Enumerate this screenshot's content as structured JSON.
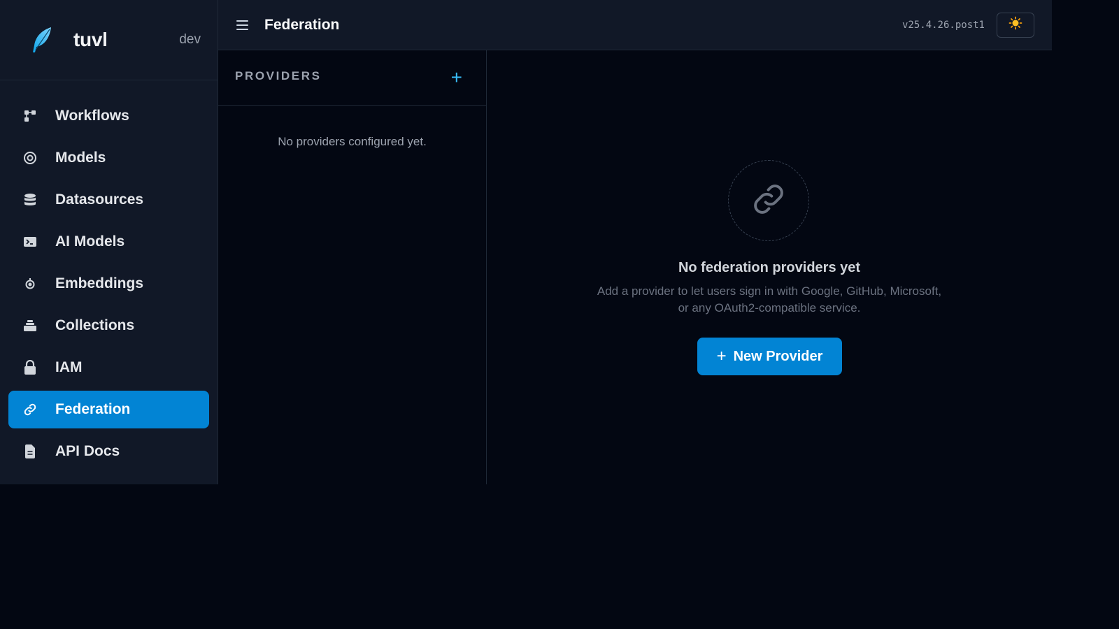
{
  "brand": {
    "name": "tuvl",
    "env": "dev",
    "logo_icon": "feather-logo-icon",
    "accent": "#0284d4"
  },
  "sidebar": {
    "items": [
      {
        "label": "Workflows",
        "icon": "workflow-icon",
        "active": false
      },
      {
        "label": "Models",
        "icon": "target-icon",
        "active": false
      },
      {
        "label": "Datasources",
        "icon": "database-icon",
        "active": false
      },
      {
        "label": "AI Models",
        "icon": "terminal-icon",
        "active": false
      },
      {
        "label": "Embeddings",
        "icon": "embedding-icon",
        "active": false
      },
      {
        "label": "Collections",
        "icon": "layers-icon",
        "active": false
      },
      {
        "label": "IAM",
        "icon": "lock-icon",
        "active": false
      },
      {
        "label": "Federation",
        "icon": "link-icon",
        "active": true
      },
      {
        "label": "API Docs",
        "icon": "document-icon",
        "active": false
      }
    ]
  },
  "header": {
    "title": "Federation",
    "version": "v25.4.26.post1",
    "theme_icon": "sun-icon"
  },
  "providers": {
    "title": "PROVIDERS",
    "add_label": "+",
    "empty_text": "No providers configured yet."
  },
  "empty_state": {
    "icon": "link-icon",
    "title": "No federation providers yet",
    "description": "Add a provider to let users sign in with Google, GitHub, Microsoft, or any OAuth2-compatible service.",
    "button_plus": "+",
    "button_label": "New Provider"
  }
}
